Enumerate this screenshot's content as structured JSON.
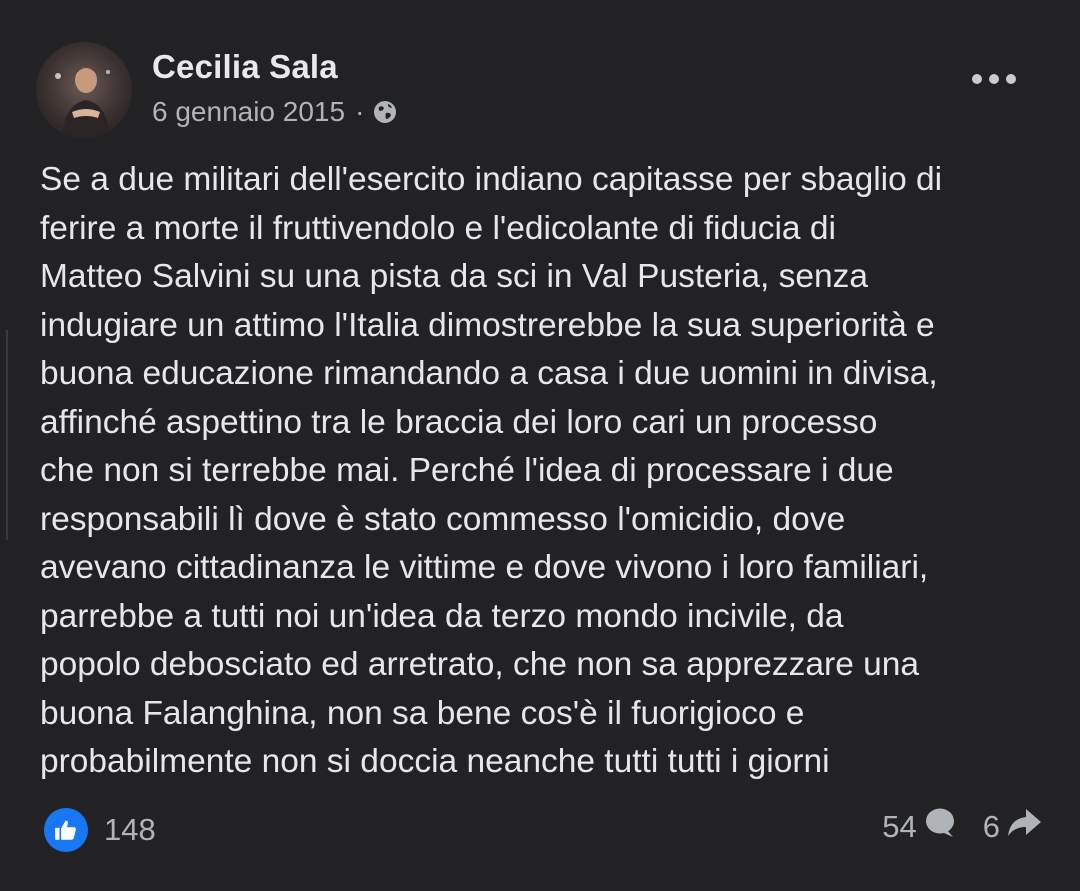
{
  "post": {
    "author": "Cecilia Sala",
    "date": "6 gennaio 2015",
    "separator": "·",
    "privacy_icon": "globe-icon",
    "more_icon": "more-options-icon",
    "text": "Se a due militari dell'esercito indiano capitasse per sbaglio di\nferire a morte il fruttivendolo e l'edicolante di fiducia di\nMatteo Salvini su una pista da sci in Val Pusteria, senza\nindugiare un attimo l'Italia dimostrerebbe la sua superiorità e\nbuona educazione rimandando a casa i due uomini in divisa,\naffinché aspettino tra le braccia dei loro cari un processo\nche non si terrebbe mai. Perché l'idea di processare i due\nresponsabili lì dove è stato commesso l'omicidio, dove\navevano cittadinanza le vittime e dove vivono i loro familiari,\nparrebbe a tutti noi un'idea da terzo mondo incivile, da\npopolo debosciato ed arretrato, che non sa apprezzare una\nbuona Falanghina, non sa bene cos'è il fuorigioco e\nprobabilmente non si doccia neanche tutti tutti i giorni"
  },
  "footer": {
    "likes": "148",
    "like_icon": "thumbs-up-icon",
    "comments": "54",
    "comment_icon": "comment-icon",
    "shares": "6",
    "share_icon": "share-icon",
    "accent": "#1877f2"
  }
}
